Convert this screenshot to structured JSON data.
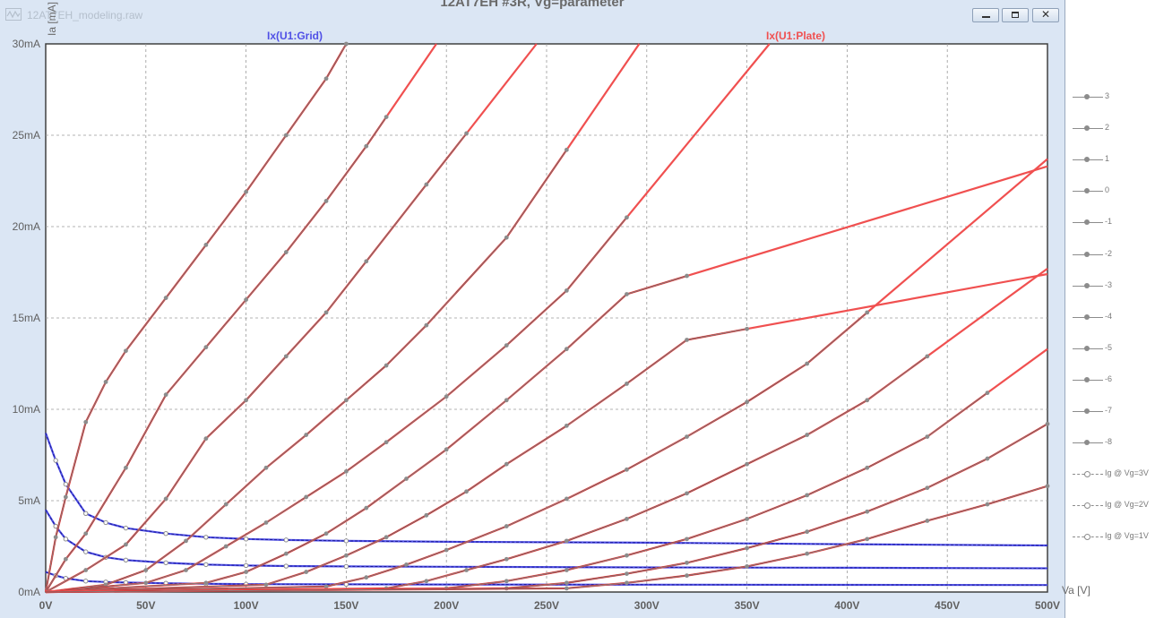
{
  "window": {
    "file_name": "12AT7EH_modeling.raw",
    "title": "12AT7EH #3R, Vg=parameter",
    "close_glyph": "✕"
  },
  "trace_labels": {
    "grid": "Ix(U1:Grid)",
    "plate": "Ix(U1:Plate)"
  },
  "x_axis_label": "Va [V]",
  "y_axis_label": "Ia [mA]",
  "legend": [
    {
      "label": "3",
      "style": "solid"
    },
    {
      "label": "2",
      "style": "solid"
    },
    {
      "label": "1",
      "style": "solid"
    },
    {
      "label": "0",
      "style": "solid"
    },
    {
      "label": "-1",
      "style": "solid"
    },
    {
      "label": "-2",
      "style": "solid"
    },
    {
      "label": "-3",
      "style": "solid"
    },
    {
      "label": "-4",
      "style": "solid"
    },
    {
      "label": "-5",
      "style": "solid"
    },
    {
      "label": "-6",
      "style": "solid"
    },
    {
      "label": "-7",
      "style": "solid"
    },
    {
      "label": "-8",
      "style": "solid"
    },
    {
      "label": "Ig @ Vg=3V",
      "style": "dashed"
    },
    {
      "label": "Ig @ Vg=2V",
      "style": "dashed"
    },
    {
      "label": "Ig @ Vg=1V",
      "style": "dashed"
    }
  ],
  "colors": {
    "plate": "#f05050",
    "plate_dark": "#8b0000",
    "grid": "#5050e6",
    "grid_dark": "#1a1a9a",
    "measured": "#8c8c8c",
    "gridline": "#9a9a9a"
  },
  "chart_data": {
    "type": "line",
    "x_ticks": [
      "0V",
      "50V",
      "100V",
      "150V",
      "200V",
      "250V",
      "300V",
      "350V",
      "400V",
      "450V",
      "500V"
    ],
    "y_ticks": [
      "0mA",
      "5mA",
      "10mA",
      "15mA",
      "20mA",
      "25mA",
      "30mA"
    ],
    "xlim": [
      0,
      500
    ],
    "ylim": [
      0,
      30
    ],
    "grid": true,
    "plate_series": [
      {
        "name": "3",
        "x": [
          0,
          5,
          10,
          20,
          30,
          40,
          60,
          80,
          100,
          120,
          140,
          150
        ],
        "y": [
          0,
          3,
          5.2,
          9.3,
          11.5,
          13.2,
          16.1,
          19,
          21.9,
          25,
          28.1,
          30
        ]
      },
      {
        "name": "2",
        "x": [
          0,
          10,
          20,
          40,
          60,
          80,
          100,
          120,
          140,
          160,
          170
        ],
        "y": [
          0,
          1.8,
          3.2,
          6.8,
          10.8,
          13.4,
          16,
          18.6,
          21.4,
          24.4,
          26
        ]
      },
      {
        "name": "1",
        "x": [
          0,
          20,
          40,
          60,
          80,
          100,
          120,
          140,
          160,
          190,
          210
        ],
        "y": [
          0,
          1.2,
          2.6,
          5.1,
          8.4,
          10.5,
          12.9,
          15.3,
          18.1,
          22.3,
          25.1
        ]
      },
      {
        "name": "0",
        "x": [
          0,
          30,
          50,
          70,
          90,
          110,
          130,
          150,
          170,
          190,
          230,
          260
        ],
        "y": [
          0,
          0.4,
          1.2,
          2.8,
          4.8,
          6.8,
          8.6,
          10.5,
          12.4,
          14.6,
          19.4,
          24.2
        ]
      },
      {
        "name": "-1",
        "x": [
          0,
          50,
          70,
          90,
          110,
          130,
          150,
          170,
          200,
          230,
          260,
          290
        ],
        "y": [
          0,
          0.5,
          1.2,
          2.5,
          3.8,
          5.2,
          6.6,
          8.2,
          10.7,
          13.5,
          16.5,
          20.5
        ]
      },
      {
        "name": "-2",
        "x": [
          0,
          80,
          100,
          120,
          140,
          160,
          180,
          200,
          230,
          260,
          290,
          320
        ],
        "y": [
          0,
          0.5,
          1.1,
          2.1,
          3.2,
          4.6,
          6.2,
          7.8,
          10.5,
          13.3,
          16.3,
          17.3
        ]
      },
      {
        "name": "-3",
        "x": [
          0,
          110,
          130,
          150,
          170,
          190,
          210,
          230,
          260,
          290,
          320,
          350
        ],
        "y": [
          0,
          0.4,
          1.1,
          2,
          3,
          4.2,
          5.5,
          7,
          9.1,
          11.4,
          13.8,
          14.4
        ]
      },
      {
        "name": "-4",
        "x": [
          0,
          140,
          160,
          180,
          200,
          230,
          260,
          290,
          320,
          350,
          380,
          410
        ],
        "y": [
          0,
          0.3,
          0.8,
          1.5,
          2.3,
          3.6,
          5.1,
          6.7,
          8.5,
          10.4,
          12.5,
          15.3
        ]
      },
      {
        "name": "-5",
        "x": [
          0,
          170,
          190,
          210,
          230,
          260,
          290,
          320,
          350,
          380,
          410,
          440
        ],
        "y": [
          0,
          0.2,
          0.6,
          1.2,
          1.8,
          2.8,
          4,
          5.4,
          7,
          8.6,
          10.5,
          12.9
        ]
      },
      {
        "name": "-6",
        "x": [
          0,
          200,
          230,
          260,
          290,
          320,
          350,
          380,
          410,
          440,
          470
        ],
        "y": [
          0,
          0.2,
          0.6,
          1.2,
          2,
          2.9,
          4,
          5.3,
          6.8,
          8.5,
          10.9
        ]
      },
      {
        "name": "-7",
        "x": [
          0,
          230,
          260,
          290,
          320,
          350,
          380,
          410,
          440,
          470,
          500
        ],
        "y": [
          0,
          0.2,
          0.5,
          1,
          1.6,
          2.4,
          3.3,
          4.4,
          5.7,
          7.3,
          9.2
        ]
      },
      {
        "name": "-8",
        "x": [
          0,
          260,
          290,
          320,
          350,
          380,
          410,
          440,
          470,
          500
        ],
        "y": [
          0,
          0.2,
          0.5,
          0.9,
          1.4,
          2.1,
          2.9,
          3.9,
          4.8,
          5.8
        ]
      }
    ],
    "grid_series": [
      {
        "name": "Ig @ Vg=3V",
        "x": [
          0,
          5,
          10,
          20,
          30,
          40,
          60,
          80,
          100,
          120,
          150,
          200,
          300,
          400,
          500
        ],
        "y": [
          8.7,
          7.2,
          5.9,
          4.3,
          3.8,
          3.5,
          3.2,
          3,
          2.9,
          2.85,
          2.8,
          2.75,
          2.7,
          2.62,
          2.55
        ]
      },
      {
        "name": "Ig @ Vg=2V",
        "x": [
          0,
          5,
          10,
          20,
          30,
          40,
          60,
          80,
          100,
          120,
          150,
          200,
          300,
          400,
          500
        ],
        "y": [
          4.5,
          3.6,
          2.9,
          2.2,
          1.9,
          1.75,
          1.6,
          1.5,
          1.45,
          1.42,
          1.4,
          1.38,
          1.35,
          1.33,
          1.3
        ]
      },
      {
        "name": "Ig @ Vg=1V",
        "x": [
          0,
          5,
          10,
          20,
          30,
          40,
          60,
          80,
          100,
          150,
          200,
          300,
          400,
          500
        ],
        "y": [
          1.1,
          0.9,
          0.75,
          0.6,
          0.55,
          0.52,
          0.48,
          0.45,
          0.43,
          0.42,
          0.41,
          0.4,
          0.39,
          0.38
        ]
      }
    ]
  }
}
